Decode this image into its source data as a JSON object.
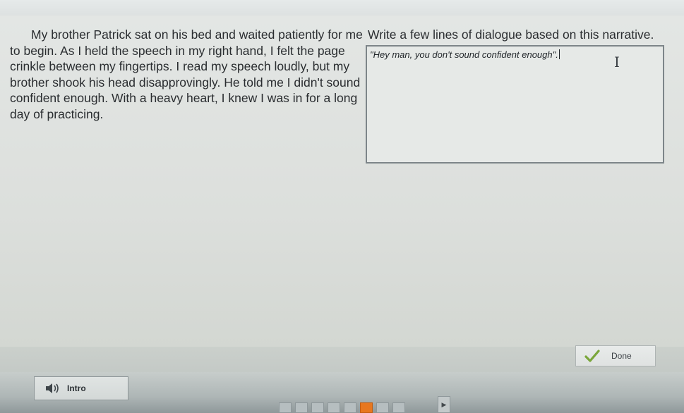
{
  "narrative": {
    "text": "My brother Patrick sat on his bed and waited patiently for me to begin. As I held the speech in my right hand, I felt the page crinkle between my fingertips. I read my speech loudly, but my brother shook his head disapprovingly. He told me I didn't sound confident enough. With a heavy heart, I knew I was in for a long day of practicing."
  },
  "activity": {
    "prompt": "Write a few lines of dialogue based on this narrative.",
    "response_value": "\"Hey man, you don't sound confident enough\"."
  },
  "controls": {
    "done_label": "Done",
    "intro_label": "Intro"
  },
  "icons": {
    "check": "check-icon",
    "speaker": "speaker-icon",
    "cursor": "text-cursor-icon",
    "next": "play-arrow-icon"
  },
  "progress": {
    "total": 8,
    "current": 6
  },
  "colors": {
    "check_green": "#7aa63a",
    "progress_current": "#e8771e"
  }
}
